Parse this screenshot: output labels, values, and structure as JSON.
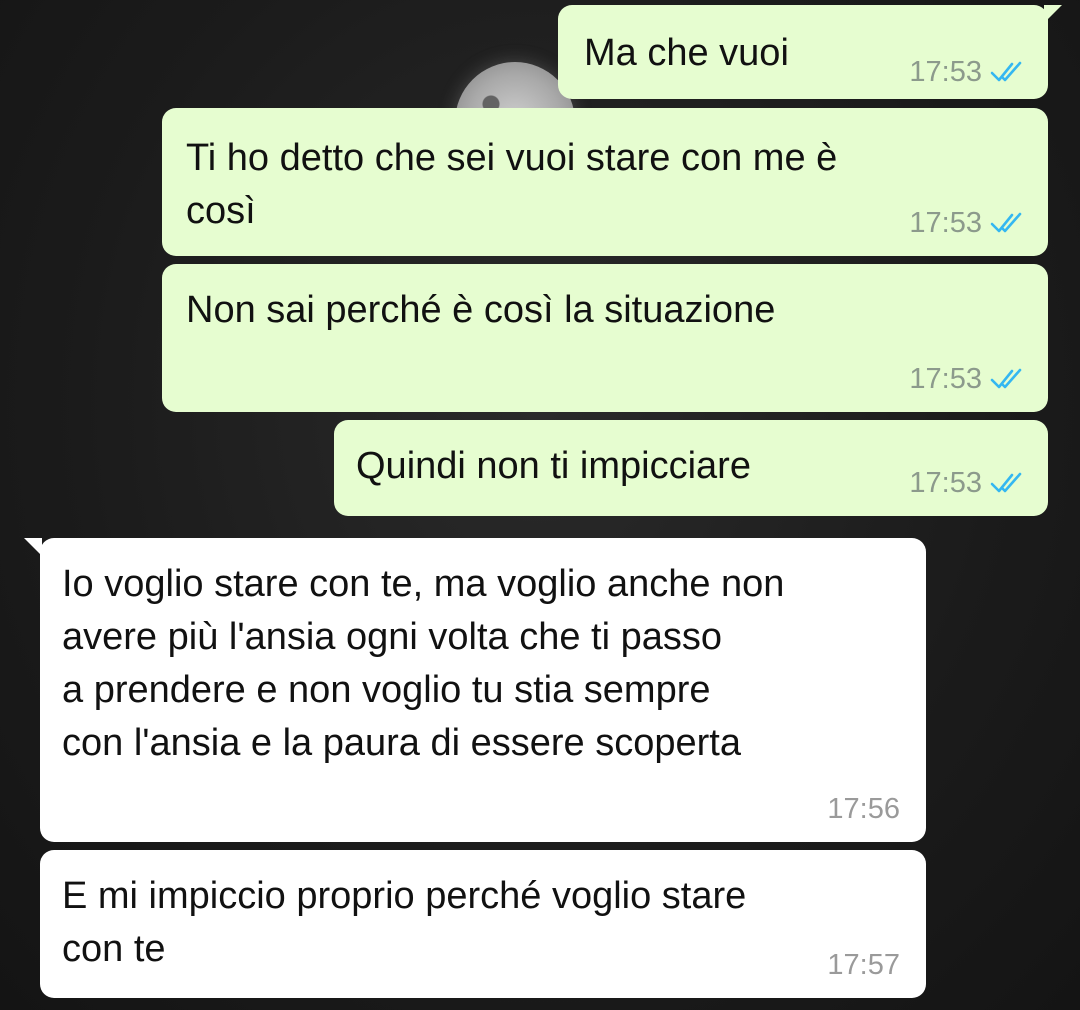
{
  "colors": {
    "outgoing_bubble": "#e6fdd0",
    "incoming_bubble": "#ffffff",
    "read_ticks": "#34b7f1"
  },
  "messages": [
    {
      "direction": "outgoing",
      "text": "Ma che vuoi",
      "time": "17:53",
      "status_icon": "double-check-read-icon"
    },
    {
      "direction": "outgoing",
      "text": "Ti ho detto che sei vuoi stare con me è\ncosì",
      "time": "17:53",
      "status_icon": "double-check-read-icon"
    },
    {
      "direction": "outgoing",
      "text": "Non sai perché è così la situazione",
      "time": "17:53",
      "status_icon": "double-check-read-icon"
    },
    {
      "direction": "outgoing",
      "text": "Quindi non ti impicciare",
      "time": "17:53",
      "status_icon": "double-check-read-icon"
    },
    {
      "direction": "incoming",
      "text": "Io voglio stare con te, ma voglio anche non\navere più l'ansia ogni volta che ti passo\na prendere e non voglio tu stia sempre\ncon l'ansia e la paura di essere scoperta",
      "time": "17:56"
    },
    {
      "direction": "incoming",
      "text": "E mi impiccio proprio perché voglio stare\ncon te",
      "time": "17:57"
    }
  ]
}
